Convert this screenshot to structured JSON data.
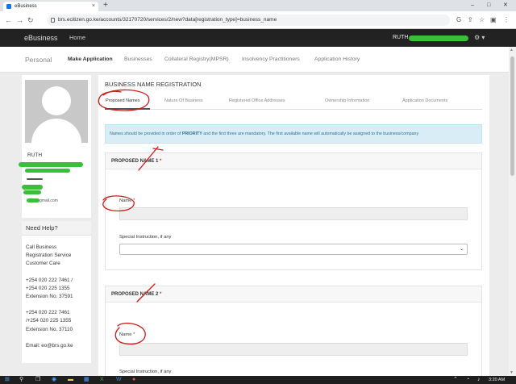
{
  "browser": {
    "tab_title": "eBusiness",
    "new_tab": "+",
    "tab_close": "×",
    "url": "brs.ecitizen.go.ke/accounts/32170720/services/2/new?data[registration_type]=business_name",
    "controls": {
      "minimize": "–",
      "maximize": "□",
      "close": "✕"
    }
  },
  "navbar": {
    "brand": "eBusiness",
    "home": "Home",
    "user": "RUTH"
  },
  "subnav": {
    "items": [
      "Personal",
      "Make Application",
      "Businesses",
      "Collateral Registry(MPSR)",
      "Insolvency Practitioners",
      "Application History"
    ]
  },
  "profile": {
    "name": "RUTH",
    "email": "gmail.com"
  },
  "help": {
    "title": "Need Help?",
    "lines": [
      "Call Business",
      "Registration Service",
      "Customer Care",
      "",
      "+254 020 222 7461 /",
      "+254 020 225 1355",
      "Extension No. 37591",
      "",
      "+254 020 222 7461",
      "/+254 020 225 1355",
      "Extension No. 37110",
      "",
      "Email: eo@brs.go.ke"
    ]
  },
  "main": {
    "title": "BUSINESS NAME REGISTRATION",
    "tabs": [
      "Proposed Names",
      "Nature Of Business",
      "Registered Office Addresses",
      "Ownership Information",
      "Application Documents"
    ],
    "alert_pre": "Names should be provided in order of ",
    "alert_strong": "PRIORITY",
    "alert_post": " and the first three are mandatory. The first available name will automatically be assigned to the business/company",
    "panels": [
      {
        "title": "PROPOSED NAME 1",
        "name_label": "Name",
        "instruction_label": "Special Instruction, if any"
      },
      {
        "title": "PROPOSED NAME 2",
        "name_label": "Name",
        "instruction_label": "Special Instruction, if any"
      }
    ],
    "required_mark": "*"
  },
  "taskbar": {
    "clock": "3:20 AM"
  },
  "colors": {
    "annotation_red": "#d11a1a",
    "scribble_green": "#3bbf3b",
    "navbar_bg": "#222222",
    "alert_bg": "#d9edf7"
  }
}
